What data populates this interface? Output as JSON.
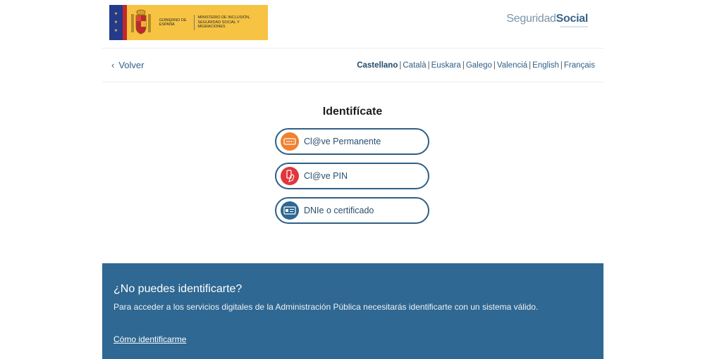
{
  "header": {
    "gov_text": "Gobierno de España",
    "ministry_text": "Ministerio de Inclusión, Seguridad Social y Migraciones",
    "brand_light": "Seguridad",
    "brand_bold": "Social"
  },
  "nav": {
    "back_label": "Volver",
    "languages": [
      {
        "label": "Castellano",
        "active": true
      },
      {
        "label": "Català"
      },
      {
        "label": "Euskara"
      },
      {
        "label": "Galego"
      },
      {
        "label": "Valenciá"
      },
      {
        "label": "English"
      },
      {
        "label": "Français"
      }
    ]
  },
  "main": {
    "title": "Identifícate",
    "options": [
      {
        "label": "Cl@ve Permanente",
        "icon": "key-card-icon",
        "color": "#f0812e"
      },
      {
        "label": "Cl@ve PIN",
        "icon": "phone-pin-icon",
        "color": "#e0363c"
      },
      {
        "label": "DNIe o certificado",
        "icon": "id-card-icon",
        "color": "#2e6893"
      }
    ]
  },
  "help": {
    "title": "¿No puedes identificarte?",
    "text": "Para acceder a los servicios digitales de la Administración Pública necesitarás identificarte con un sistema válido.",
    "link": "Cómo identificarme"
  },
  "colors": {
    "accent": "#2e6893",
    "border": "#2f5f86"
  }
}
